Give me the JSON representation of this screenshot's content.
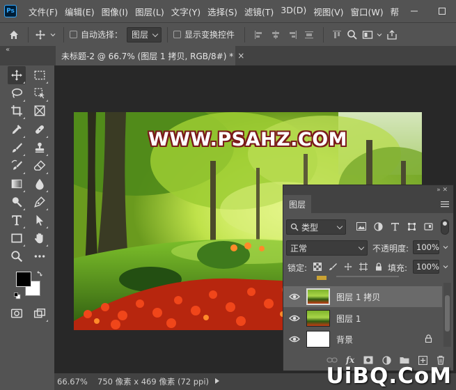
{
  "app": {
    "logo_text": "Ps"
  },
  "menu": [
    "文件(F)",
    "编辑(E)",
    "图像(I)",
    "图层(L)",
    "文字(Y)",
    "选择(S)",
    "滤镜(T)",
    "3D(D)",
    "视图(V)",
    "窗口(W)",
    "帮"
  ],
  "options_bar": {
    "auto_select_label": "自动选择：",
    "auto_select_value": "图层",
    "show_transform_label": "显示变换控件"
  },
  "document": {
    "tab_title": "未标题-2 @ 66.7% (图层 1 拷贝, RGB/8#) *",
    "watermark": "WWW.PSAHZ.COM"
  },
  "status": {
    "zoom": "66.67%",
    "doc_size": "750 像素 x 469 像素 (72 ppi)"
  },
  "colors": {
    "foreground": "#000000",
    "background": "#ffffff",
    "accent": "#31a8ff"
  },
  "layers_panel": {
    "tab": "图层",
    "filter_kind": "类型",
    "blend_mode": "正常",
    "opacity_label": "不透明度:",
    "opacity_value": "100%",
    "lock_label": "锁定:",
    "fill_label": "填充:",
    "fill_value": "100%",
    "layers": [
      {
        "name": "图层 1 拷贝",
        "selected": true,
        "visible": true,
        "locked": false,
        "thumb": "forest"
      },
      {
        "name": "图层 1",
        "selected": false,
        "visible": true,
        "locked": false,
        "thumb": "forest"
      },
      {
        "name": "背景",
        "selected": false,
        "visible": true,
        "locked": true,
        "thumb": "white"
      }
    ]
  },
  "corner_logo": "UiBQ.CoM"
}
